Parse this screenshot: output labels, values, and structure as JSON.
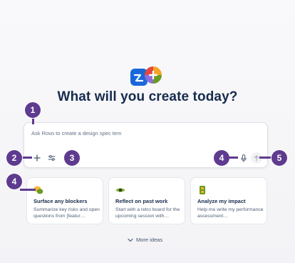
{
  "header": {
    "title": "What will you create today?"
  },
  "prompt": {
    "placeholder": "Ask Rovo to create a design spec tem"
  },
  "callouts": [
    "1",
    "2",
    "3",
    "4",
    "5",
    "4"
  ],
  "cards": [
    {
      "title": "Surface any blockers",
      "desc": "Summarize key risks and open questions from [featur…",
      "icon": "chat-bubbles-icon"
    },
    {
      "title": "Reflect on past work",
      "desc": "Start with a retro board for the upcoming session with…",
      "icon": "eye-icon"
    },
    {
      "title": "Analyze my impact",
      "desc": "Help me write my performance assessment…",
      "icon": "trophy-icon"
    }
  ],
  "footer": {
    "more_label": "More ideas"
  },
  "colors": {
    "accent": "#5e3b8f",
    "brand": "#1868db",
    "title": "#172b4d"
  }
}
